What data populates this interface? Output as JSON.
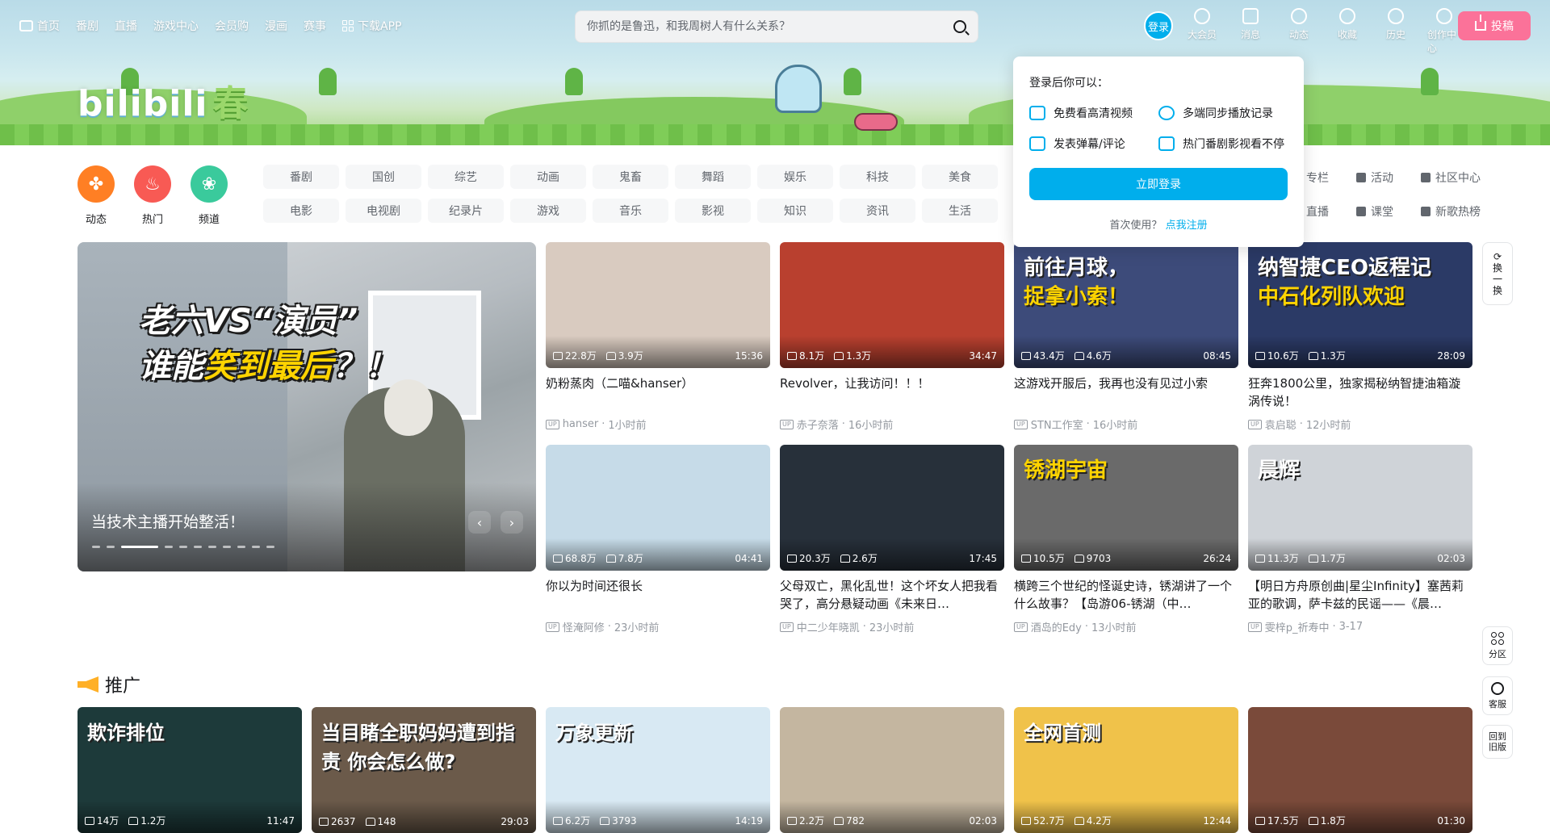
{
  "topnav": {
    "items": [
      "首页",
      "番剧",
      "直播",
      "游戏中心",
      "会员购",
      "漫画",
      "赛事",
      "下载APP"
    ]
  },
  "search": {
    "placeholder": "你抓的是鲁迅，和我周树人有什么关系？"
  },
  "user_nav": {
    "login": "登录",
    "items": [
      "大会员",
      "消息",
      "动态",
      "收藏",
      "历史",
      "创作中心"
    ],
    "upload": "投稿"
  },
  "banner": {
    "logo": "bilibili",
    "logo_season": "春"
  },
  "channels": {
    "round": [
      {
        "label": "动态",
        "icon": "fan-icon"
      },
      {
        "label": "热门",
        "icon": "flame-icon"
      },
      {
        "label": "频道",
        "icon": "channels-icon"
      }
    ],
    "tags": [
      "番剧",
      "国创",
      "综艺",
      "动画",
      "鬼畜",
      "舞蹈",
      "娱乐",
      "科技",
      "美食",
      "电影",
      "电视剧",
      "纪录片",
      "游戏",
      "音乐",
      "影视",
      "知识",
      "资讯",
      "生活"
    ],
    "side": [
      "专栏",
      "活动",
      "社区中心",
      "直播",
      "课堂",
      "新歌热榜"
    ]
  },
  "login_popover": {
    "heading": "登录后你可以：",
    "perks": [
      "免费看高清视频",
      "多端同步播放记录",
      "发表弹幕/评论",
      "热门番剧影视看不停"
    ],
    "button": "立即登录",
    "first_use": "首次使用？",
    "register": "点我注册"
  },
  "hero": {
    "caption_line1_a": "老六VS",
    "caption_line1_b": "“演员”",
    "caption_line2_a": "谁能",
    "caption_line2_b": "笑到最后",
    "caption_line2_c": "？！",
    "title": "当技术主播开始整活！",
    "prev": "‹",
    "next": "›",
    "slide_count": 11,
    "active_slide": 3
  },
  "cards": [
    {
      "views": "22.8万",
      "likes": "3.9万",
      "duration": "15:36",
      "title": "奶粉蒸肉（二喵&hanser）",
      "author": "hanser",
      "time": "1小时前",
      "bg": "#d9cbc0"
    },
    {
      "views": "8.1万",
      "likes": "1.3万",
      "duration": "34:47",
      "title": "Revolver，让我访问！！！",
      "author": "赤子奈落",
      "time": "16小时前",
      "bg": "#b9402f"
    },
    {
      "views": "43.4万",
      "likes": "4.6万",
      "duration": "08:45",
      "title": "这游戏开服后，我再也没有见过小索",
      "author": "STN工作室",
      "time": "16小时前",
      "bg": "#3d4b7a",
      "overlay1": "前往月球，",
      "overlay2": "捉拿小索！"
    },
    {
      "views": "10.6万",
      "likes": "1.3万",
      "duration": "28:09",
      "title": "狂奔1800公里，独家揭秘纳智捷油箱漩涡传说！",
      "author": "袁启聪",
      "time": "12小时前",
      "bg": "#2b3a66",
      "overlay1": "纳智捷CEO返程记",
      "overlay2": "中石化列队欢迎"
    },
    {
      "views": "68.8万",
      "likes": "7.8万",
      "duration": "04:41",
      "title": "你以为时间还很长",
      "author": "怪淹阿修",
      "time": "23小时前",
      "bg": "#c6dbe8"
    },
    {
      "views": "20.3万",
      "likes": "2.6万",
      "duration": "17:45",
      "title": "父母双亡，黑化乱世！这个坏女人把我看哭了，高分悬疑动画《未来日…",
      "author": "中二少年晓凯",
      "time": "23小时前",
      "bg": "#27303a"
    },
    {
      "views": "10.5万",
      "likes": "9703",
      "duration": "26:24",
      "title": "横跨三个世纪的怪诞史诗，锈湖讲了一个什么故事？【岛游06-锈湖（中…",
      "author": "酒岛的Edy",
      "time": "13小时前",
      "bg": "#6a6a6a",
      "overlay2": "锈湖宇宙"
    },
    {
      "views": "11.3万",
      "likes": "1.7万",
      "duration": "02:03",
      "title": "【明日方舟原创曲|星尘Infinity】塞茜莉亚的歌调，萨卡兹的民谣——《晨…",
      "author": "雯梓p_祈寿中",
      "time": "3-17",
      "bg": "#cfd3d8",
      "overlay1": "晨辉"
    }
  ],
  "floaters": {
    "swap": [
      "换",
      "一",
      "换"
    ],
    "zone": "分区",
    "service": "客服",
    "old_version": [
      "回到",
      "旧版"
    ]
  },
  "promo": {
    "heading": "推广",
    "cards": [
      {
        "views": "14万",
        "likes": "1.2万",
        "duration": "11:47",
        "bg": "#1d3a3a",
        "overlay": "欺诈排位"
      },
      {
        "views": "2637",
        "likes": "148",
        "duration": "29:03",
        "bg": "#6b5a4a",
        "overlay": "当目睹全职妈妈遭到指责 你会怎么做?"
      },
      {
        "views": "6.2万",
        "likes": "3793",
        "duration": "14:19",
        "bg": "#d8e9f3",
        "overlay": "万象更新"
      },
      {
        "views": "2.2万",
        "likes": "782",
        "duration": "02:03",
        "bg": "#c4b6a0"
      },
      {
        "views": "52.7万",
        "likes": "4.2万",
        "duration": "12:44",
        "bg": "#f0c24a",
        "overlay": "全网首测"
      },
      {
        "views": "17.5万",
        "likes": "1.8万",
        "duration": "01:30",
        "bg": "#7a4a3a"
      }
    ]
  },
  "colors": {
    "brand_blue": "#00aeec",
    "brand_pink": "#fb7299"
  }
}
